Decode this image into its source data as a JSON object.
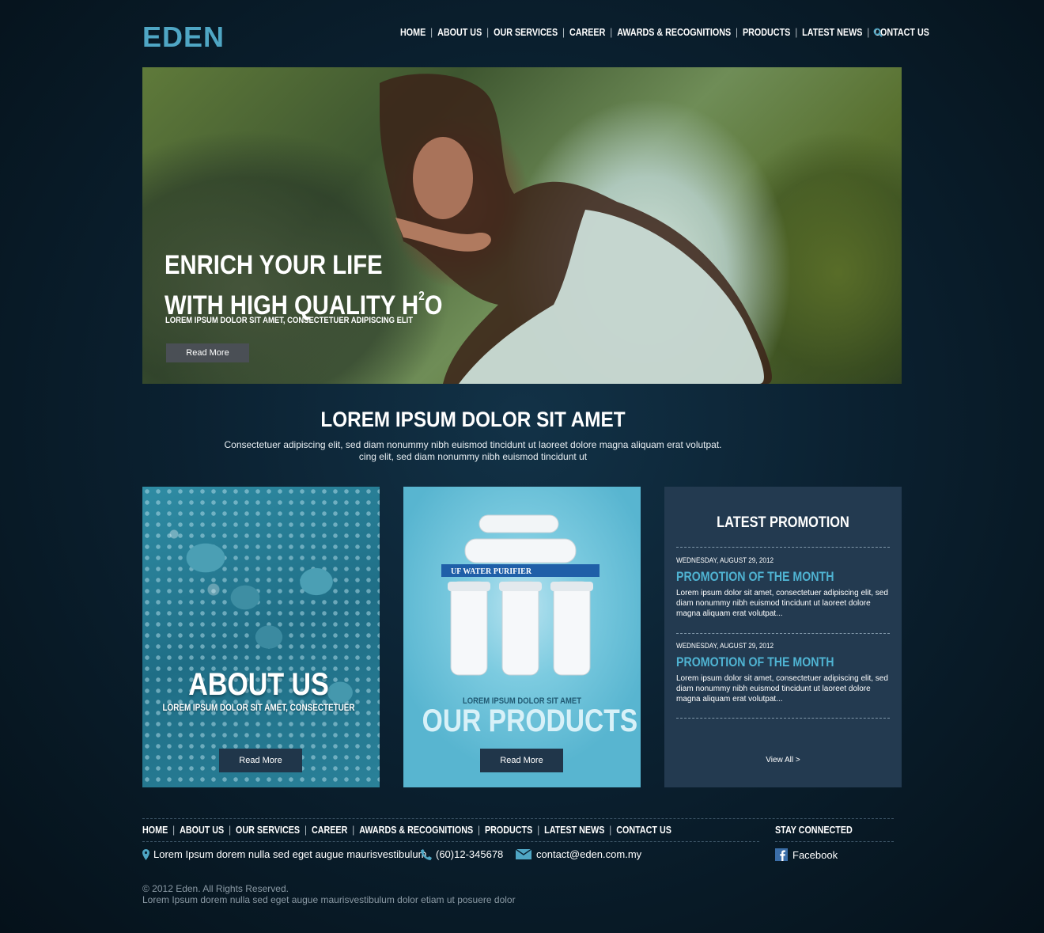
{
  "brand": {
    "logo_text": "EDEN",
    "accent": "#4fa6c4"
  },
  "nav": {
    "items": [
      "HOME",
      "ABOUT US",
      "OUR SERVICES",
      "CAREER",
      "AWARDS & RECOGNITIONS",
      "PRODUCTS",
      "LATEST NEWS",
      "CONTACT US"
    ],
    "search_icon": "search-icon"
  },
  "hero": {
    "title_line1": "ENRICH YOUR LIFE",
    "title_line2": "WITH HIGH QUALITY H",
    "title_sup": "2",
    "title_end": "O",
    "subtitle": "LOREM IPSUM DOLOR SIT AMET, CONSECTETUER ADIPISCING ELIT",
    "button": "Read More"
  },
  "intro": {
    "title": "LOREM IPSUM DOLOR SIT AMET",
    "line1": "Consectetuer adipiscing elit, sed diam nonummy nibh euismod tincidunt ut laoreet dolore magna aliquam erat volutpat.",
    "line2": "cing elit, sed diam nonummy nibh euismod tincidunt ut"
  },
  "about_card": {
    "title": "ABOUT US",
    "subtitle": "LOREM IPSUM DOLOR SIT AMET, CONSECTETUER",
    "button": "Read More"
  },
  "products_card": {
    "label": "UF WATER PURIFIER",
    "subtitle": "LOREM IPSUM DOLOR SIT AMET",
    "title": "OUR PRODUCTS",
    "button": "Read More"
  },
  "promo_card": {
    "title": "LATEST PROMOTION",
    "items": [
      {
        "date": "WEDNESDAY, AUGUST 29, 2012",
        "heading": "PROMOTION OF THE MONTH",
        "body": "Lorem ipsum dolor sit amet, consectetuer adipiscing elit, sed diam nonummy nibh euismod tincidunt ut laoreet dolore magna aliquam erat volutpat..."
      },
      {
        "date": "WEDNESDAY, AUGUST 29, 2012",
        "heading": "PROMOTION OF THE MONTH",
        "body": "Lorem ipsum dolor sit amet, consectetuer adipiscing elit, sed diam nonummy nibh euismod tincidunt ut laoreet dolore magna aliquam erat volutpat..."
      }
    ],
    "view_all": "View All >"
  },
  "footer": {
    "nav": [
      "HOME",
      "ABOUT US",
      "OUR SERVICES",
      "CAREER",
      "AWARDS & RECOGNITIONS",
      "PRODUCTS",
      "LATEST NEWS",
      "CONTACT US"
    ],
    "stay_connected": "STAY CONNECTED",
    "address": "Lorem Ipsum dorem nulla sed eget augue maurisvestibulum",
    "phone": "(60)12-345678",
    "email": "contact@eden.com.my",
    "facebook": "Facebook",
    "copyright": "© 2012 Eden. All Rights Reserved.",
    "tagline": "Lorem Ipsum dorem nulla sed eget augue maurisvestibulum dolor etiam ut posuere dolor"
  }
}
